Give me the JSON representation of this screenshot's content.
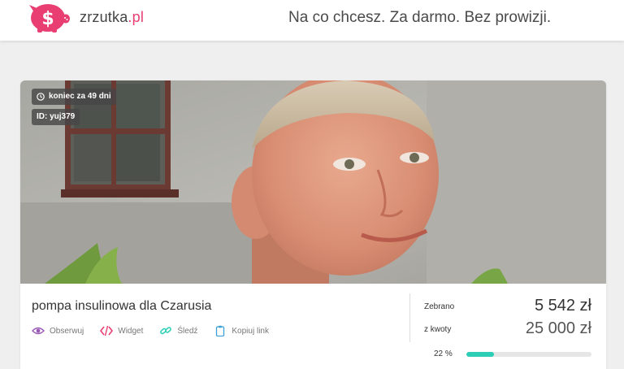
{
  "header": {
    "logo_text": "zrzutka",
    "logo_domain": ".pl",
    "tagline": "Na co chcesz. Za darmo. Bez prowizji.",
    "brand_color": "#e83e72"
  },
  "fundraiser": {
    "days_badge": "koniec za 49 dni",
    "id_badge": "ID: yuj379",
    "title": "pompa insulinowa dla Czarusia",
    "actions": [
      {
        "label": "Obserwuj",
        "icon": "eye-icon",
        "color": "#9b59b6"
      },
      {
        "label": "Widget",
        "icon": "code-icon",
        "color": "#e83e72"
      },
      {
        "label": "Śledź",
        "icon": "link-icon",
        "color": "#2ccfb5"
      },
      {
        "label": "Kopiuj link",
        "icon": "clipboard-icon",
        "color": "#3aa0d8"
      }
    ],
    "collected_label": "Zebrano",
    "collected_value": "5 542 zł",
    "goal_label": "z kwoty",
    "goal_value": "25 000 zł",
    "progress_text": "22 %",
    "progress_fraction": 0.22,
    "progress_color": "#2ccfb5"
  }
}
